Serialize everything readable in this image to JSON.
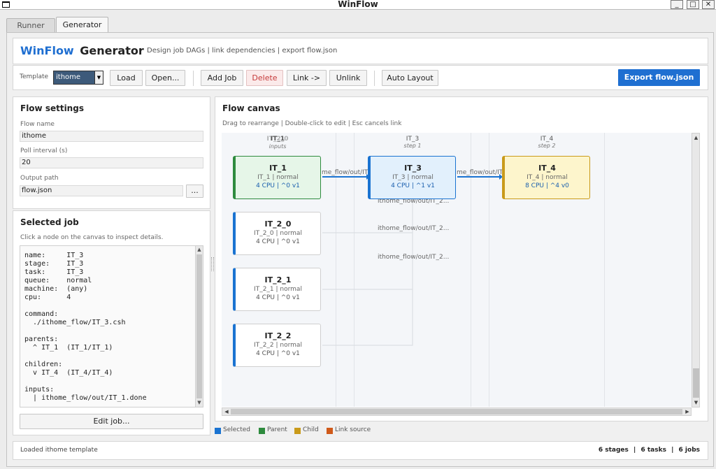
{
  "window": {
    "title": "WinFlow"
  },
  "tabs": [
    "Runner",
    "Generator"
  ],
  "header": {
    "brand": "WinFlow",
    "title": "Generator",
    "subtitle": "Design job DAGs | link dependencies | export flow.json"
  },
  "toolbar": {
    "template_label": "Template",
    "template_value": "ithome",
    "load": "Load",
    "open": "Open...",
    "add_job": "Add Job",
    "delete": "Delete",
    "link": "Link ->",
    "unlink": "Unlink",
    "auto_layout": "Auto Layout",
    "export": "Export flow.json"
  },
  "flow_settings": {
    "title": "Flow settings",
    "flow_name_label": "Flow name",
    "flow_name": "ithome",
    "poll_label": "Poll interval (s)",
    "poll": "20",
    "output_label": "Output path",
    "output": "flow.json",
    "browse": "..."
  },
  "selected_job": {
    "title": "Selected job",
    "hint": "Click a node on the canvas to inspect details.",
    "details": "name:     IT_3\nstage:    IT_3\ntask:     IT_3\nqueue:    normal\nmachine:  (any)\ncpu:      4\n\ncommand:\n  ./ithome_flow/IT_3.csh\n\nparents:\n  ^ IT_1  (IT_1/IT_1)\n\nchildren:\n  v IT_4  (IT_4/IT_4)\n\ninputs:\n  | ithome_flow/out/IT_1.done",
    "edit": "Edit job..."
  },
  "canvas": {
    "title": "Flow canvas",
    "hint": "Drag to rearrange | Double-click to edit | Esc cancels link",
    "columns": [
      {
        "name": "IT_1",
        "overlap": "IT_2_0",
        "sub": "inputs"
      },
      {
        "name": "IT_3",
        "sub": "step 1"
      },
      {
        "name": "IT_4",
        "sub": "step 2"
      }
    ],
    "nodes": [
      {
        "id": "IT_1",
        "sub": "IT_1 | normal",
        "info": "4 CPU  |  ^0  v1"
      },
      {
        "id": "IT_3",
        "sub": "IT_3 | normal",
        "info": "4 CPU  |  ^1  v1"
      },
      {
        "id": "IT_4",
        "sub": "IT_4 | normal",
        "info": "8 CPU  |  ^4  v0"
      },
      {
        "id": "IT_2_0",
        "sub": "IT_2_0 | normal",
        "info": "4 CPU  |  ^0  v1"
      },
      {
        "id": "IT_2_1",
        "sub": "IT_2_1 | normal",
        "info": "4 CPU  |  ^0  v1"
      },
      {
        "id": "IT_2_2",
        "sub": "IT_2_2 | normal",
        "info": "4 CPU  |  ^0  v1"
      }
    ],
    "edge_labels": [
      "me_flow/out/IT",
      "me_flow/out/IT",
      "ithome_flow/out/IT_2...",
      "ithome_flow/out/IT_2...",
      "ithome_flow/out/IT_2..."
    ],
    "legend": [
      {
        "label": "Selected",
        "color": "#1a73d1"
      },
      {
        "label": "Parent",
        "color": "#2e8b3e"
      },
      {
        "label": "Child",
        "color": "#c99a1a"
      },
      {
        "label": "Link source",
        "color": "#d05a1a"
      }
    ]
  },
  "status": {
    "message": "Loaded ithome template",
    "stages": "6 stages",
    "tasks": "6 tasks",
    "jobs": "6 jobs",
    "sep": "|"
  }
}
